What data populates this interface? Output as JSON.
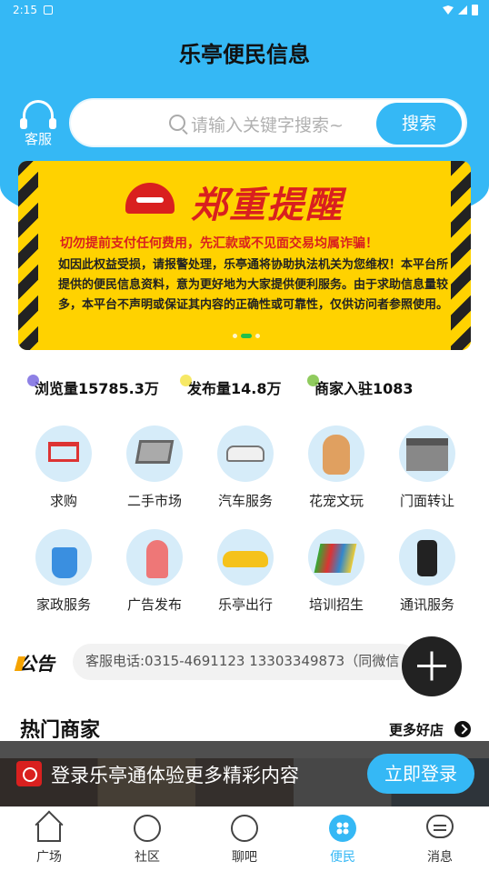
{
  "status_bar": {
    "time": "2:15"
  },
  "header": {
    "title": "乐亭便民信息"
  },
  "customer_service": {
    "label": "客服"
  },
  "search": {
    "placeholder": "请输入关键字搜索~",
    "button_label": "搜索"
  },
  "banner": {
    "title": "郑重提醒",
    "warning": "切勿提前支付任何费用，先汇款或不见面交易均属诈骗！",
    "body": "如因此权益受损，请报警处理，乐亭通将协助执法机关为您维权！本平台所提供的便民信息资料，意为更好地为大家提供便利服务。由于求助信息量较多，本平台不声明或保证其内容的正确性或可靠性，仅供访问者参照使用。",
    "dots": 3,
    "active_dot": 1
  },
  "stats": [
    {
      "label": "浏览量15785.3万",
      "dot_color": "#7a6be0"
    },
    {
      "label": "发布量14.8万",
      "dot_color": "#f4e44a"
    },
    {
      "label": "商家入驻1083",
      "dot_color": "#7dc242"
    }
  ],
  "categories": [
    {
      "label": "求购",
      "icon": "shopping-cart-icon"
    },
    {
      "label": "二手市场",
      "icon": "laptop-icon"
    },
    {
      "label": "汽车服务",
      "icon": "car-icon"
    },
    {
      "label": "花宠文玩",
      "icon": "cat-icon"
    },
    {
      "label": "门面转让",
      "icon": "storefront-icon"
    },
    {
      "label": "家政服务",
      "icon": "cleaning-bucket-icon"
    },
    {
      "label": "广告发布",
      "icon": "megaphone-icon"
    },
    {
      "label": "乐亭出行",
      "icon": "taxi-icon"
    },
    {
      "label": "培训招生",
      "icon": "books-icon"
    },
    {
      "label": "通讯服务",
      "icon": "phone-icon"
    }
  ],
  "notice": {
    "logo": "公告",
    "text": "客服电话:0315-4691123 13303349873（同微信"
  },
  "hot_merchants": {
    "title": "热门商家",
    "more_label": "更多好店"
  },
  "login_prompt": {
    "text": "登录乐亭通体验更多精彩内容",
    "button_label": "立即登录"
  },
  "tabs": [
    {
      "label": "广场",
      "icon": "home-icon",
      "active": false
    },
    {
      "label": "社区",
      "icon": "community-icon",
      "active": false
    },
    {
      "label": "聊吧",
      "icon": "chat-icon",
      "active": false
    },
    {
      "label": "便民",
      "icon": "services-icon",
      "active": true
    },
    {
      "label": "消息",
      "icon": "message-icon",
      "active": false
    }
  ],
  "colors": {
    "primary": "#35b8f5",
    "warning_red": "#d9201f",
    "banner_yellow": "#ffd200"
  }
}
